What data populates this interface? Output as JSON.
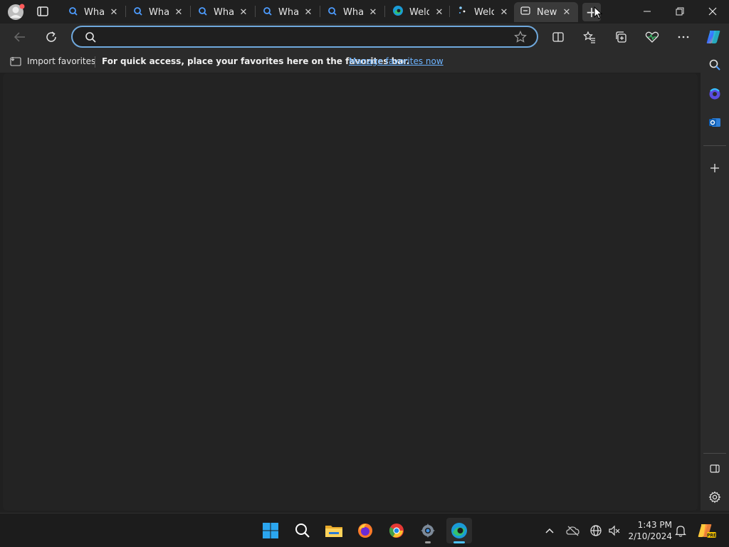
{
  "tabs": [
    {
      "title": "What",
      "icon": "search-icon"
    },
    {
      "title": "What",
      "icon": "search-icon"
    },
    {
      "title": "What",
      "icon": "search-icon"
    },
    {
      "title": "What",
      "icon": "search-icon"
    },
    {
      "title": "What",
      "icon": "search-icon"
    },
    {
      "title": "Welc",
      "icon": "edge-icon"
    },
    {
      "title": "Welc",
      "icon": "sparkle-icon"
    },
    {
      "title": "New",
      "icon": "newtab-icon"
    }
  ],
  "tab_close_glyph": "✕",
  "new_tab_glyph": "+",
  "favorites": {
    "import_label": "Import favorites",
    "message": "For quick access, place your favorites here on the favorites bar.",
    "manage_link": "Manage favorites now"
  },
  "address": {
    "value": "",
    "placeholder": ""
  },
  "clock": {
    "time": "1:43 PM",
    "date": "2/10/2024"
  },
  "colors": {
    "accent": "#6fa8dc",
    "link": "#6cb3ff",
    "background": "#202020"
  }
}
